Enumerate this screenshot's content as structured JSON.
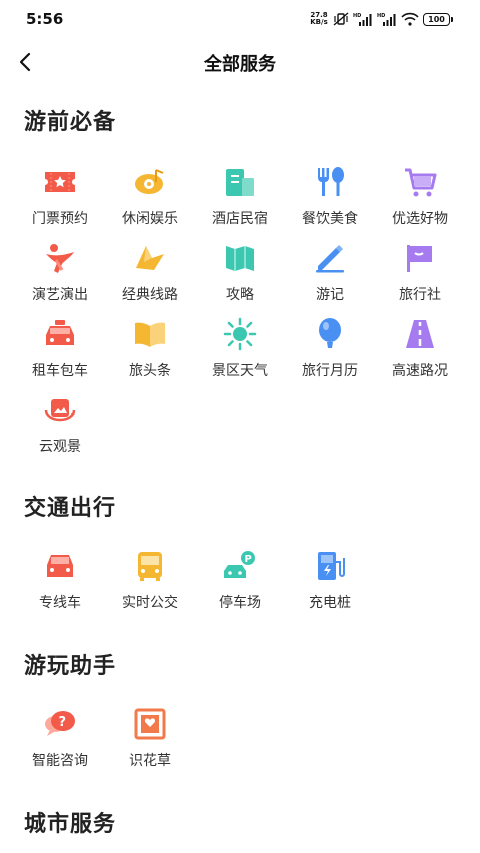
{
  "status_bar": {
    "time": "5:56",
    "net_speed_value": "27.8",
    "net_speed_unit": "KB/s",
    "battery": "100"
  },
  "header": {
    "back_icon": "chevron-left-icon",
    "title": "全部服务"
  },
  "sections": [
    {
      "title": "游前必备",
      "items": [
        {
          "label": "门票预约",
          "icon": "ticket-icon",
          "color": "#F25A4A"
        },
        {
          "label": "休闲娱乐",
          "icon": "music-disc-icon",
          "color": "#F5B731"
        },
        {
          "label": "酒店民宿",
          "icon": "hotel-icon",
          "color": "#3CC7B0"
        },
        {
          "label": "餐饮美食",
          "icon": "fork-spoon-icon",
          "color": "#4A90F2"
        },
        {
          "label": "优选好物",
          "icon": "shopping-cart-icon",
          "color": "#A77BF0"
        },
        {
          "label": "演艺演出",
          "icon": "performer-icon",
          "color": "#F25A4A"
        },
        {
          "label": "经典线路",
          "icon": "route-arrow-icon",
          "color": "#F5B731"
        },
        {
          "label": "攻略",
          "icon": "map-guide-icon",
          "color": "#3CC7B0"
        },
        {
          "label": "游记",
          "icon": "pen-note-icon",
          "color": "#4A90F2"
        },
        {
          "label": "旅行社",
          "icon": "flag-icon",
          "color": "#A77BF0"
        },
        {
          "label": "租车包车",
          "icon": "taxi-icon",
          "color": "#F25A4A"
        },
        {
          "label": "旅头条",
          "icon": "open-book-icon",
          "color": "#F5B731"
        },
        {
          "label": "景区天气",
          "icon": "sun-icon",
          "color": "#3CC7B0"
        },
        {
          "label": "旅行月历",
          "icon": "balloon-icon",
          "color": "#4A90F2"
        },
        {
          "label": "高速路况",
          "icon": "highway-icon",
          "color": "#A77BF0"
        },
        {
          "label": "云观景",
          "icon": "cloud-view-icon",
          "color": "#F25A4A"
        }
      ]
    },
    {
      "title": "交通出行",
      "items": [
        {
          "label": "专线车",
          "icon": "car-icon",
          "color": "#F25A4A"
        },
        {
          "label": "实时公交",
          "icon": "bus-icon",
          "color": "#F5B731"
        },
        {
          "label": "停车场",
          "icon": "parking-icon",
          "color": "#3CC7B0"
        },
        {
          "label": "充电桩",
          "icon": "charging-station-icon",
          "color": "#4A90F2"
        }
      ]
    },
    {
      "title": "游玩助手",
      "items": [
        {
          "label": "智能咨询",
          "icon": "chat-question-icon",
          "color": "#F25A4A"
        },
        {
          "label": "识花草",
          "icon": "flower-scan-icon",
          "color": "#F27A4A"
        }
      ]
    },
    {
      "title": "城市服务",
      "items": []
    }
  ]
}
